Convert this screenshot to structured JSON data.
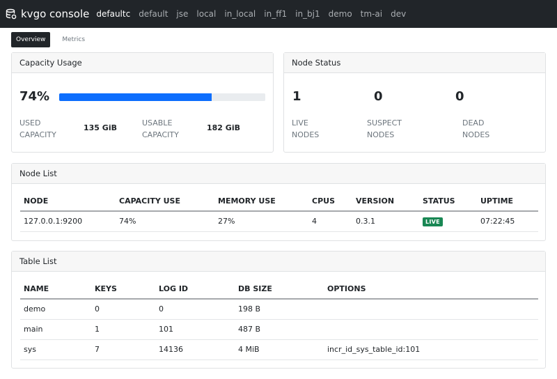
{
  "app": {
    "title": "kvgo console",
    "nav": [
      "defaultc",
      "default",
      "jse",
      "local",
      "in_local",
      "in_ff1",
      "in_bj1",
      "demo",
      "tm-ai",
      "dev"
    ]
  },
  "tabs": [
    "Overview",
    "Metrics"
  ],
  "capacity": {
    "title": "Capacity Usage",
    "percent": "74%",
    "fill_fraction": 0.74,
    "used_label_1": "USED",
    "used_label_2": "CAPACITY",
    "used_value": "135 GiB",
    "usable_label_1": "USABLE",
    "usable_label_2": "CAPACITY",
    "usable_value": "182 GiB"
  },
  "node_status": {
    "title": "Node Status",
    "live": "1",
    "live_l1": "LIVE",
    "live_l2": "NODES",
    "suspect": "0",
    "suspect_l1": "SUSPECT",
    "suspect_l2": "NODES",
    "dead": "0",
    "dead_l1": "DEAD",
    "dead_l2": "NODES"
  },
  "node_list": {
    "title": "Node List",
    "headers": [
      "NODE",
      "CAPACITY USE",
      "MEMORY USE",
      "CPUS",
      "VERSION",
      "STATUS",
      "UPTIME"
    ],
    "rows": [
      [
        "127.0.0.1:9200",
        "74%",
        "27%",
        "4",
        "0.3.1",
        "LIVE",
        "07:22:45"
      ]
    ]
  },
  "table_list": {
    "title": "Table List",
    "headers": [
      "NAME",
      "KEYS",
      "LOG ID",
      "DB SIZE",
      "OPTIONS"
    ],
    "rows": [
      [
        "demo",
        "0",
        "0",
        "198 B",
        ""
      ],
      [
        "main",
        "1",
        "101",
        "487 B",
        ""
      ],
      [
        "sys",
        "7",
        "14136",
        "4 MiB",
        "incr_id_sys_table_id:101"
      ]
    ]
  },
  "colors": {
    "navbar": "#212529",
    "progress": "#0d6efd",
    "live_badge": "#198754"
  }
}
